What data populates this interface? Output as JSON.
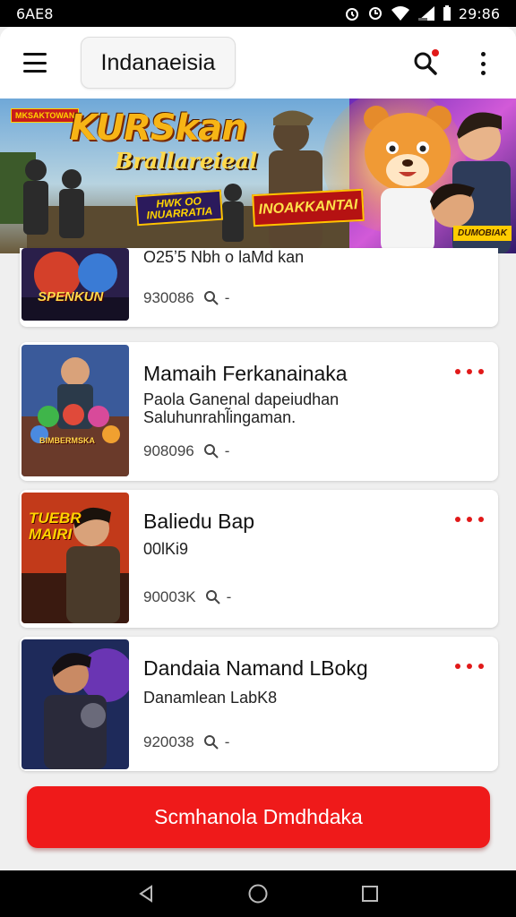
{
  "status_bar": {
    "left_text": "6AE8",
    "time": "29:86"
  },
  "app_bar": {
    "title": "Indanaeisia"
  },
  "banner": {
    "title": "KURSkan",
    "subtitle": "Brallareieal",
    "badge_left": "MKSAKTOWAN",
    "box1": "HWK OO INUARRATIA",
    "box2": "INOAKKANTAI",
    "badge_right": "DUMOBIAK"
  },
  "items": [
    {
      "thumb_label": "SPENKUN",
      "partial_title": "O25ʼ5  Nbh o laMd kan",
      "meta": "930086"
    },
    {
      "thumb_label": "BIMBERMSKA",
      "title": "Mamaih Ferkanainaka",
      "desc": "Paola Ganenal  dapeiudhan\nSaluhunrahl̃ingaman.",
      "meta": "908096"
    },
    {
      "thumb_label": "TUEBR MAIRI",
      "title": "Baliedu Bap",
      "desc": "00lKi9",
      "meta": "90003K"
    },
    {
      "thumb_label": "",
      "title": "Dandaia Namand  LBokg",
      "desc": "Danamlean LabK8",
      "meta": "920038"
    }
  ],
  "meta_dash": "-",
  "cta": {
    "label": "Scmhanola Dmdhdaka"
  },
  "colors": {
    "accent": "#ef1a1a",
    "dots": "#e11919"
  },
  "icons": {
    "menu": "hamburger-icon",
    "search": "search-icon",
    "more": "more-vertical-icon",
    "nav_back": "back-triangle-icon",
    "nav_home": "home-circle-icon",
    "nav_recent": "recent-square-icon"
  }
}
